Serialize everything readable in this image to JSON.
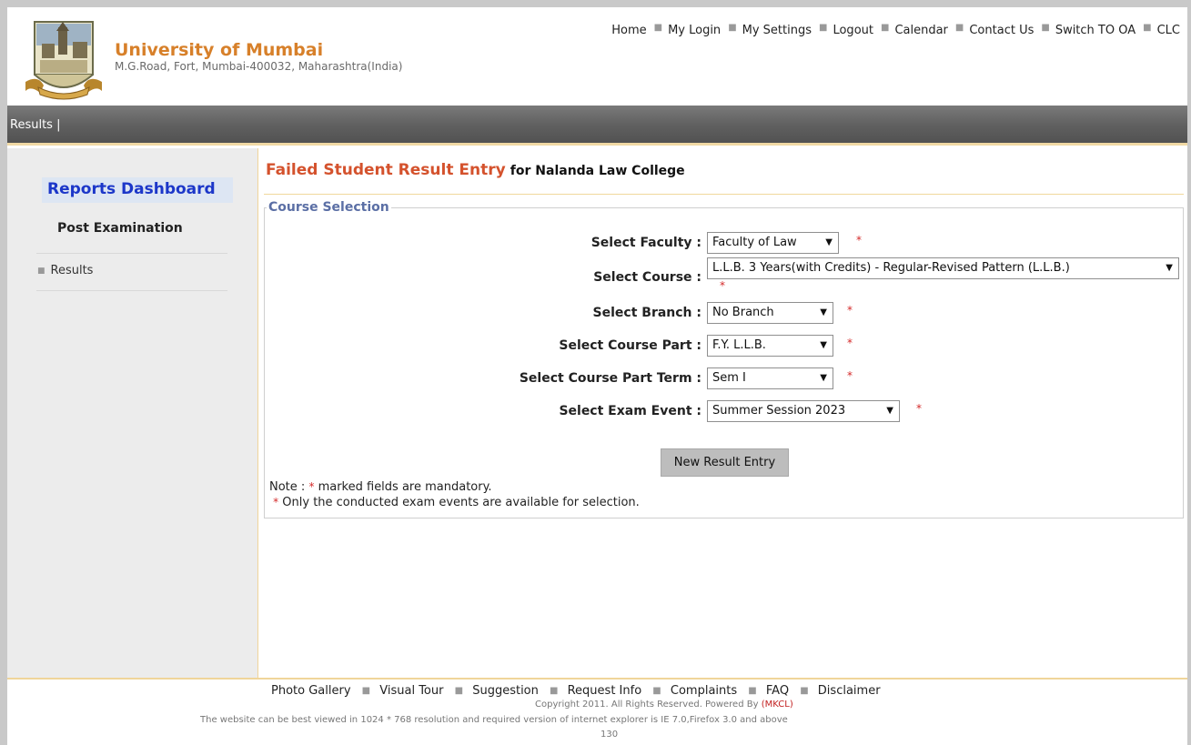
{
  "header": {
    "university_name": "University of Mumbai",
    "address": "M.G.Road, Fort, Mumbai-400032, Maharashtra(India)",
    "nav": [
      "Home",
      "My Login",
      "My Settings",
      "Logout",
      "Calendar",
      "Contact Us",
      "Switch TO OA",
      "CLC"
    ]
  },
  "menubar": {
    "label": "Results |"
  },
  "sidebar": {
    "title": "Reports Dashboard",
    "section": "Post Examination",
    "items": [
      {
        "label": "Results"
      }
    ]
  },
  "main": {
    "title_red": "Failed Student Result Entry",
    "title_black": "for Nalanda Law College",
    "fieldset_legend": "Course Selection",
    "fields": [
      {
        "label": "Select Faculty :",
        "value": "Faculty of Law"
      },
      {
        "label": "Select Course :",
        "value": "L.L.B. 3 Years(with Credits) - Regular-Revised Pattern (L.L.B.)"
      },
      {
        "label": "Select Branch :",
        "value": "No Branch"
      },
      {
        "label": "Select Course Part :",
        "value": "F.Y. L.L.B."
      },
      {
        "label": "Select Course Part Term :",
        "value": "Sem I"
      },
      {
        "label": "Select Exam Event :",
        "value": "Summer Session 2023"
      }
    ],
    "required_mark": "*",
    "button_label": "New Result Entry",
    "note_prefix": "Note :",
    "note_line1": "marked fields are mandatory.",
    "note_line2": "Only the conducted exam events are available for selection."
  },
  "footer": {
    "links": [
      "Photo Gallery",
      "Visual Tour",
      "Suggestion",
      "Request Info",
      "Complaints",
      "FAQ",
      "Disclaimer"
    ],
    "copyright": "Copyright 2011. All Rights Reserved. Powered By",
    "powered_by": "(MKCL)",
    "resolution_note": "The website can be best viewed in 1024 * 768 resolution and required version of internet explorer is IE 7.0,Firefox 3.0 and above",
    "counter": "130"
  }
}
